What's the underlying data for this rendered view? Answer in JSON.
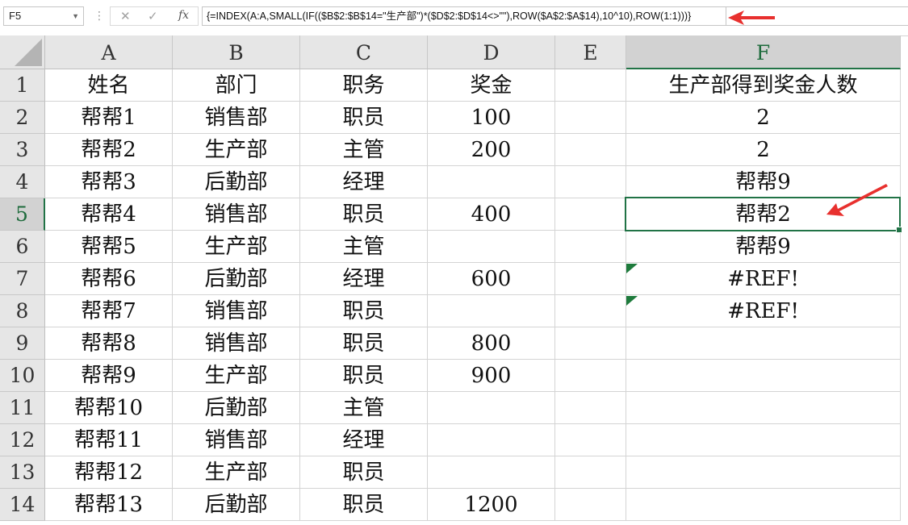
{
  "formula_bar": {
    "name_box": "F5",
    "formula": "{=INDEX(A:A,SMALL(IF(($B$2:$B$14=\"生产部\")*($D$2:$D$14<>\"\"),ROW($A$2:$A$14),10^10),ROW(1:1)))}"
  },
  "columns": [
    "A",
    "B",
    "C",
    "D",
    "E",
    "F"
  ],
  "selected": {
    "column": "F",
    "row": 5
  },
  "rows": [
    {
      "num": "1",
      "cells": [
        "姓名",
        "部门",
        "职务",
        "奖金",
        "",
        "生产部得到奖金人数"
      ]
    },
    {
      "num": "2",
      "cells": [
        "帮帮1",
        "销售部",
        "职员",
        "100",
        "",
        "2"
      ]
    },
    {
      "num": "3",
      "cells": [
        "帮帮2",
        "生产部",
        "主管",
        "200",
        "",
        "2"
      ]
    },
    {
      "num": "4",
      "cells": [
        "帮帮3",
        "后勤部",
        "经理",
        "",
        "",
        "帮帮9"
      ]
    },
    {
      "num": "5",
      "cells": [
        "帮帮4",
        "销售部",
        "职员",
        "400",
        "",
        "帮帮2"
      ]
    },
    {
      "num": "6",
      "cells": [
        "帮帮5",
        "生产部",
        "主管",
        "",
        "",
        "帮帮9"
      ]
    },
    {
      "num": "7",
      "cells": [
        "帮帮6",
        "后勤部",
        "经理",
        "600",
        "",
        "#REF!"
      ]
    },
    {
      "num": "8",
      "cells": [
        "帮帮7",
        "销售部",
        "职员",
        "",
        "",
        "#REF!"
      ]
    },
    {
      "num": "9",
      "cells": [
        "帮帮8",
        "销售部",
        "职员",
        "800",
        "",
        ""
      ]
    },
    {
      "num": "10",
      "cells": [
        "帮帮9",
        "生产部",
        "职员",
        "900",
        "",
        ""
      ]
    },
    {
      "num": "11",
      "cells": [
        "帮帮10",
        "后勤部",
        "主管",
        "",
        "",
        ""
      ]
    },
    {
      "num": "12",
      "cells": [
        "帮帮11",
        "销售部",
        "经理",
        "",
        "",
        ""
      ]
    },
    {
      "num": "13",
      "cells": [
        "帮帮12",
        "生产部",
        "职员",
        "",
        "",
        ""
      ]
    },
    {
      "num": "14",
      "cells": [
        "帮帮13",
        "后勤部",
        "职员",
        "1200",
        "",
        ""
      ]
    }
  ],
  "colors": {
    "accent": "#217346",
    "arrow": "#e8302e",
    "error_triangle": "#1e7b3c"
  }
}
